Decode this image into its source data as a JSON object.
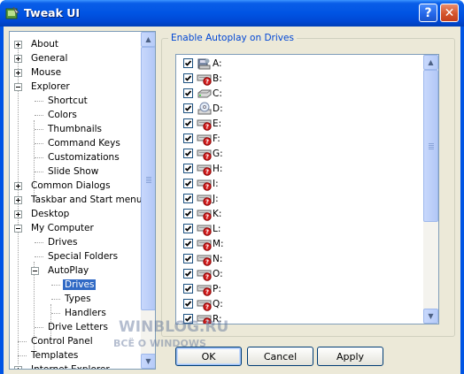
{
  "window": {
    "title": "Tweak UI",
    "help_glyph": "?",
    "close_glyph": "✕"
  },
  "tree": {
    "items": [
      {
        "label": "About",
        "expander": "plus",
        "selected": false
      },
      {
        "label": "General",
        "expander": "plus",
        "selected": false
      },
      {
        "label": "Mouse",
        "expander": "plus",
        "selected": false
      },
      {
        "label": "Explorer",
        "expander": "minus",
        "selected": false
      },
      {
        "label": "Shortcut",
        "expander": "none",
        "selected": false
      },
      {
        "label": "Colors",
        "expander": "none",
        "selected": false
      },
      {
        "label": "Thumbnails",
        "expander": "none",
        "selected": false
      },
      {
        "label": "Command Keys",
        "expander": "none",
        "selected": false
      },
      {
        "label": "Customizations",
        "expander": "none",
        "selected": false
      },
      {
        "label": "Slide Show",
        "expander": "none",
        "selected": false
      },
      {
        "label": "Common Dialogs",
        "expander": "plus",
        "selected": false
      },
      {
        "label": "Taskbar and Start menu",
        "expander": "plus",
        "selected": false
      },
      {
        "label": "Desktop",
        "expander": "plus",
        "selected": false
      },
      {
        "label": "My Computer",
        "expander": "minus",
        "selected": false
      },
      {
        "label": "Drives",
        "expander": "none",
        "selected": false
      },
      {
        "label": "Special Folders",
        "expander": "none",
        "selected": false
      },
      {
        "label": "AutoPlay",
        "expander": "minus",
        "selected": false
      },
      {
        "label": "Drives",
        "expander": "none",
        "selected": true
      },
      {
        "label": "Types",
        "expander": "none",
        "selected": false
      },
      {
        "label": "Handlers",
        "expander": "none",
        "selected": false
      },
      {
        "label": "Drive Letters",
        "expander": "none",
        "selected": false
      },
      {
        "label": "Control Panel",
        "expander": "none",
        "selected": false
      },
      {
        "label": "Templates",
        "expander": "none",
        "selected": false
      },
      {
        "label": "Internet Explorer",
        "expander": "plus",
        "selected": false
      }
    ]
  },
  "autoplay": {
    "group_title": "Enable Autoplay on Drives",
    "drives": [
      {
        "label": "A:",
        "checked": true,
        "icon": "floppy-drive-icon"
      },
      {
        "label": "B:",
        "checked": true,
        "icon": "missing-drive-icon"
      },
      {
        "label": "C:",
        "checked": true,
        "icon": "hard-drive-icon"
      },
      {
        "label": "D:",
        "checked": true,
        "icon": "cd-drive-icon"
      },
      {
        "label": "E:",
        "checked": true,
        "icon": "missing-drive-icon"
      },
      {
        "label": "F:",
        "checked": true,
        "icon": "missing-drive-icon"
      },
      {
        "label": "G:",
        "checked": true,
        "icon": "missing-drive-icon"
      },
      {
        "label": "H:",
        "checked": true,
        "icon": "missing-drive-icon"
      },
      {
        "label": "I:",
        "checked": true,
        "icon": "missing-drive-icon"
      },
      {
        "label": "J:",
        "checked": true,
        "icon": "missing-drive-icon"
      },
      {
        "label": "K:",
        "checked": true,
        "icon": "missing-drive-icon"
      },
      {
        "label": "L:",
        "checked": true,
        "icon": "missing-drive-icon"
      },
      {
        "label": "M:",
        "checked": true,
        "icon": "missing-drive-icon"
      },
      {
        "label": "N:",
        "checked": true,
        "icon": "missing-drive-icon"
      },
      {
        "label": "O:",
        "checked": true,
        "icon": "missing-drive-icon"
      },
      {
        "label": "P:",
        "checked": true,
        "icon": "missing-drive-icon"
      },
      {
        "label": "Q:",
        "checked": true,
        "icon": "missing-drive-icon"
      },
      {
        "label": "R:",
        "checked": true,
        "icon": "missing-drive-icon"
      }
    ]
  },
  "buttons": {
    "ok": "OK",
    "cancel": "Cancel",
    "apply": "Apply"
  },
  "watermark": {
    "line1": "WINBLOG.RU",
    "line2": "ВСЁ О WINDOWS"
  },
  "colors": {
    "titlebar": "#0054e3",
    "selection": "#316ac5",
    "group_title": "#0046d5",
    "dialog_bg": "#ece9d8"
  }
}
